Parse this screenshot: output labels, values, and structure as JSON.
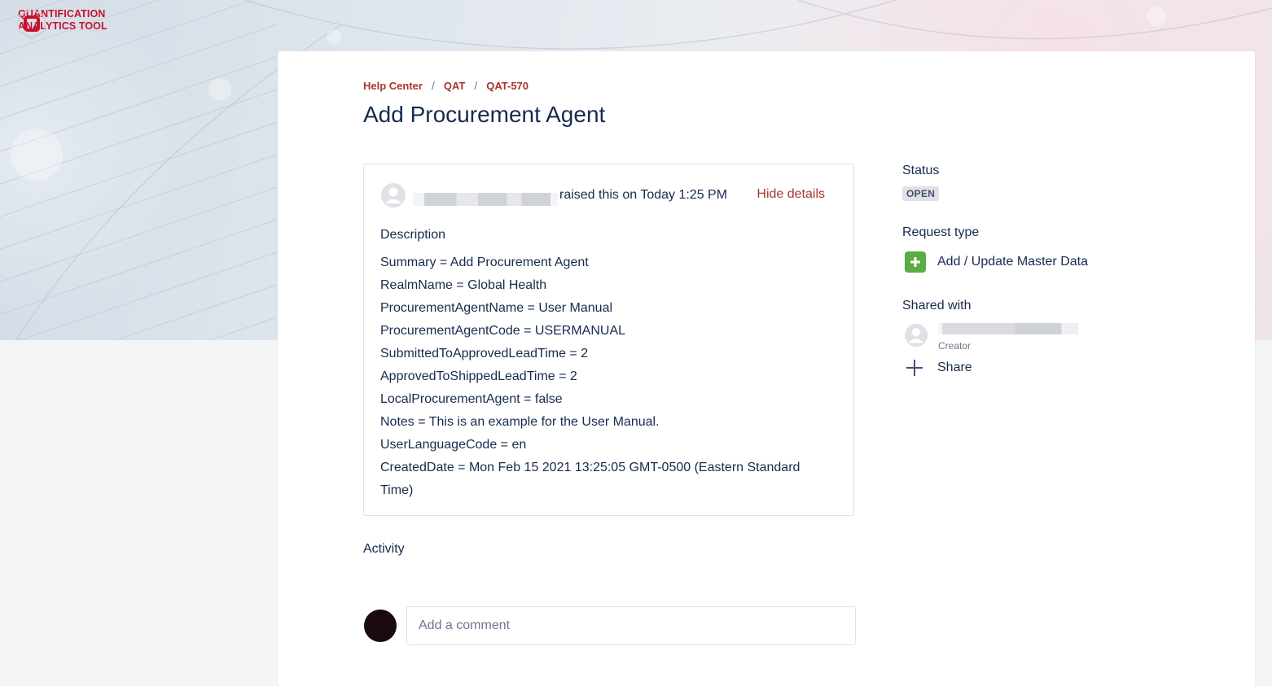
{
  "brand": {
    "name_line1": "QUANTIFICATION",
    "name_line2": "ANALYTICS TOOL",
    "logo_letter": "Q",
    "color": "#c8102e"
  },
  "breadcrumb": [
    {
      "label": "Help Center"
    },
    {
      "label": "QAT"
    },
    {
      "label": "QAT-570"
    }
  ],
  "breadcrumb_separator": "/",
  "title": "Add Procurement Agent",
  "request": {
    "raised_text": "raised this on Today 1:25 PM",
    "hide_details_label": "Hide details",
    "description_label": "Description",
    "description_lines": [
      "Summary = Add Procurement Agent",
      "RealmName = Global Health",
      "ProcurementAgentName = User Manual",
      "ProcurementAgentCode = USERMANUAL",
      "SubmittedToApprovedLeadTime = 2",
      "ApprovedToShippedLeadTime = 2",
      "LocalProcurementAgent = false",
      "Notes = This is an example for the User Manual.",
      "UserLanguageCode = en",
      "CreatedDate = Mon Feb 15 2021 13:25:05 GMT-0500 (Eastern Standard Time)"
    ]
  },
  "activity": {
    "label": "Activity",
    "comment_placeholder": "Add a comment"
  },
  "sidebar": {
    "status_label": "Status",
    "status_value": "OPEN",
    "request_type_label": "Request type",
    "request_type_value": "Add / Update Master Data",
    "request_type_icon": "plus-icon",
    "request_type_color": "#5aac44",
    "shared_with_label": "Shared with",
    "creator_label": "Creator",
    "share_label": "Share"
  },
  "colors": {
    "link": "#a8362b",
    "text": "#172b4d",
    "muted": "#6b778c"
  }
}
